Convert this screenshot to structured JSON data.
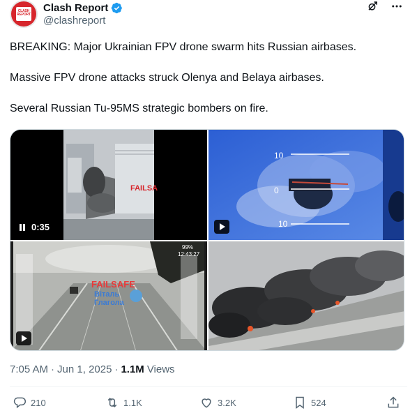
{
  "author": {
    "display_name": "Clash Report",
    "handle": "@clashreport",
    "avatar_text": "CLASH REPORT"
  },
  "tweet": {
    "paragraphs": [
      "BREAKING: Major Ukrainian FPV drone swarm hits Russian airbases.",
      "Massive FPV drone attacks struck Olenya and Belaya airbases.",
      "Several Russian Tu-95MS strategic bombers on fire."
    ]
  },
  "media": {
    "video1_duration": "0:35",
    "video1_overlay": "FAILSA",
    "video2_hud": [
      "10",
      "0",
      "10"
    ],
    "video3_overlay": "FAILSAFE",
    "video3_caption": [
      "Віталь",
      "Глагола"
    ],
    "video3_hud_top": "99%",
    "video3_hud_time": "12:43:27"
  },
  "meta": {
    "time": "7:05 AM",
    "separator": "·",
    "date": "Jun 1, 2025",
    "views_count": "1.1M",
    "views_label": "Views"
  },
  "actions": {
    "replies": "210",
    "reposts": "1.1K",
    "likes": "3.2K",
    "bookmarks": "524"
  },
  "colors": {
    "text_primary": "#0f1419",
    "text_secondary": "#536471",
    "verified": "#1d9bf0",
    "brand_red": "#d7262c"
  },
  "icons": [
    "verified-badge-icon",
    "grok-icon",
    "more-icon",
    "pause-icon",
    "play-icon",
    "reply-icon",
    "repost-icon",
    "like-icon",
    "bookmark-icon",
    "share-icon"
  ]
}
